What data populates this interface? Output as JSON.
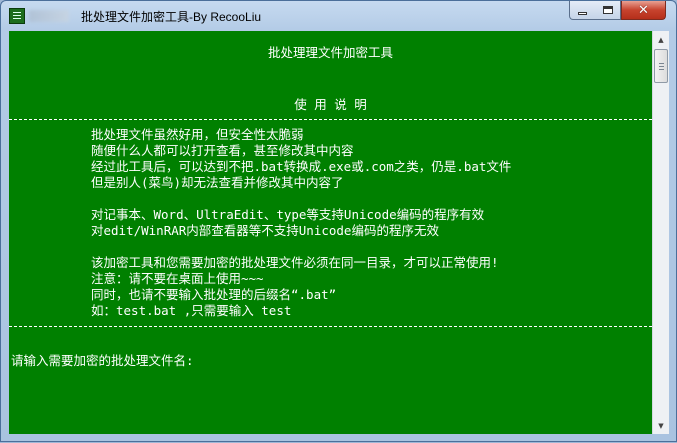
{
  "window": {
    "title": "批处理文件加密工具-By RecooLiu",
    "controls": {
      "minimize_icon": "minimize-icon",
      "maximize_icon": "maximize-icon",
      "close_icon": "close-icon",
      "close_glyph": "✕"
    }
  },
  "console": {
    "heading": "批处理理文件加密工具",
    "subheading": "使 用 说 明",
    "separator": "------------------------------------------------------------------------------------------------------------------",
    "notes": [
      "批处理文件虽然好用，但安全性太脆弱",
      "随便什么人都可以打开查看，甚至修改其中内容",
      "经过此工具后，可以达到不把.bat转换成.exe或.com之类，仍是.bat文件",
      "但是别人(菜鸟)却无法查看并修改其中内容了",
      "",
      "对记事本、Word、UltraEdit、type等支持Unicode编码的程序有效",
      "对edit/WinRAR内部查看器等不支持Unicode编码的程序无效",
      "",
      "该加密工具和您需要加密的批处理文件必须在同一目录，才可以正常使用!",
      "注意：请不要在桌面上使用~~~",
      "同时，也请不要输入批处理的后缀名“.bat”",
      "如：test.bat ,只需要输入 test"
    ],
    "prompt": "请输入需要加密的批处理文件名:"
  },
  "colors": {
    "console_bg": "#008000",
    "console_fg": "#ffffff",
    "close_button": "#c7432e"
  }
}
